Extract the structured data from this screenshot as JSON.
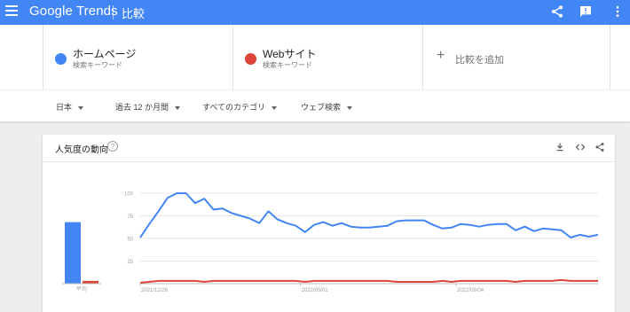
{
  "header": {
    "brand": "Google Trends",
    "page_title": "比較",
    "icons": [
      "menu-icon",
      "share-icon",
      "feedback-icon",
      "more-vert-icon"
    ]
  },
  "terms": [
    {
      "name": "ホームページ",
      "subtitle": "検索キーワード",
      "color": "#4285f4"
    },
    {
      "name": "Webサイト",
      "subtitle": "検索キーワード",
      "color": "#db4437"
    }
  ],
  "add_term": {
    "label": "比較を追加"
  },
  "filters": {
    "region": "日本",
    "period": "過去 12 か月間",
    "category": "すべてのカテゴリ",
    "search_type": "ウェブ検索"
  },
  "card": {
    "title": "人気度の動向",
    "help": "?"
  },
  "chart_data": {
    "type": "line",
    "ylim": [
      0,
      100
    ],
    "yticks": [
      25,
      50,
      75,
      100
    ],
    "x_tick_labels": [
      "2021/12/26",
      "2022/05/01",
      "2022/09/04"
    ],
    "average_label": "平均",
    "averages": [
      {
        "name": "ホームページ",
        "value": 68,
        "color": "#4285f4"
      },
      {
        "name": "Webサイト",
        "value": 3,
        "color": "#db4437"
      }
    ],
    "series": [
      {
        "name": "ホームページ",
        "color": "#4285f4",
        "values": [
          51,
          66,
          80,
          95,
          100,
          100,
          89,
          94,
          82,
          83,
          78,
          75,
          72,
          67,
          80,
          71,
          67,
          64,
          57,
          65,
          68,
          64,
          67,
          63,
          62,
          62,
          63,
          64,
          69,
          70,
          70,
          70,
          65,
          61,
          62,
          66,
          65,
          63,
          65,
          66,
          66,
          59,
          63,
          58,
          61,
          60,
          59,
          51,
          54,
          52,
          54
        ]
      },
      {
        "name": "Webサイト",
        "color": "#db4437",
        "values": [
          1,
          2,
          3,
          3,
          3,
          3,
          3,
          2,
          3,
          3,
          3,
          3,
          3,
          3,
          3,
          3,
          3,
          3,
          2,
          3,
          3,
          3,
          3,
          3,
          3,
          3,
          3,
          3,
          2,
          2,
          2,
          2,
          2,
          3,
          2,
          3,
          3,
          3,
          3,
          3,
          3,
          2,
          3,
          3,
          3,
          3,
          4,
          3,
          3,
          3,
          3
        ]
      }
    ]
  }
}
